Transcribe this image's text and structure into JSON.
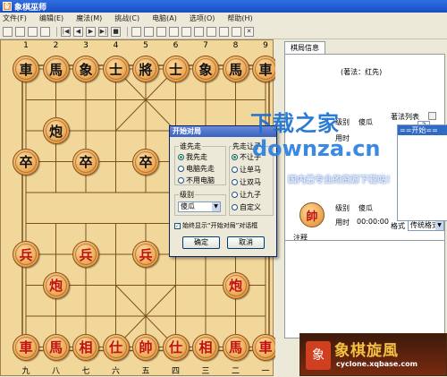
{
  "window": {
    "title": "象棋巫师"
  },
  "menu": [
    "文件(F)",
    "编辑(E)",
    "魔法(M)",
    "挑战(C)",
    "电脑(A)",
    "选项(O)",
    "帮助(H)"
  ],
  "board": {
    "top_numbers": [
      "1",
      "2",
      "3",
      "4",
      "5",
      "6",
      "7",
      "8",
      "9"
    ],
    "bottom_numbers": [
      "九",
      "八",
      "七",
      "六",
      "五",
      "四",
      "三",
      "二",
      "一"
    ],
    "pieces": [
      {
        "ch": "車",
        "side": "black",
        "col": 0,
        "row": 0
      },
      {
        "ch": "馬",
        "side": "black",
        "col": 1,
        "row": 0
      },
      {
        "ch": "象",
        "side": "black",
        "col": 2,
        "row": 0
      },
      {
        "ch": "士",
        "side": "black",
        "col": 3,
        "row": 0
      },
      {
        "ch": "將",
        "side": "black",
        "col": 4,
        "row": 0
      },
      {
        "ch": "士",
        "side": "black",
        "col": 5,
        "row": 0
      },
      {
        "ch": "象",
        "side": "black",
        "col": 6,
        "row": 0
      },
      {
        "ch": "馬",
        "side": "black",
        "col": 7,
        "row": 0
      },
      {
        "ch": "車",
        "side": "black",
        "col": 8,
        "row": 0
      },
      {
        "ch": "炮",
        "side": "black",
        "col": 1,
        "row": 2
      },
      {
        "ch": "卒",
        "side": "black",
        "col": 0,
        "row": 3
      },
      {
        "ch": "卒",
        "side": "black",
        "col": 2,
        "row": 3
      },
      {
        "ch": "卒",
        "side": "black",
        "col": 4,
        "row": 3
      },
      {
        "ch": "兵",
        "side": "red",
        "col": 0,
        "row": 6
      },
      {
        "ch": "兵",
        "side": "red",
        "col": 2,
        "row": 6
      },
      {
        "ch": "兵",
        "side": "red",
        "col": 4,
        "row": 6
      },
      {
        "ch": "炮",
        "side": "red",
        "col": 1,
        "row": 7
      },
      {
        "ch": "炮",
        "side": "red",
        "col": 7,
        "row": 7
      },
      {
        "ch": "車",
        "side": "red",
        "col": 0,
        "row": 9
      },
      {
        "ch": "馬",
        "side": "red",
        "col": 1,
        "row": 9
      },
      {
        "ch": "相",
        "side": "red",
        "col": 2,
        "row": 9
      },
      {
        "ch": "仕",
        "side": "red",
        "col": 3,
        "row": 9
      },
      {
        "ch": "帥",
        "side": "red",
        "col": 4,
        "row": 9
      },
      {
        "ch": "仕",
        "side": "red",
        "col": 5,
        "row": 9
      },
      {
        "ch": "相",
        "side": "red",
        "col": 6,
        "row": 9
      },
      {
        "ch": "馬",
        "side": "red",
        "col": 7,
        "row": 9
      },
      {
        "ch": "車",
        "side": "red",
        "col": 8,
        "row": 9
      }
    ]
  },
  "panel": {
    "tab": "棋局信息",
    "move_turn": "(著法：红先)",
    "level_label": "级别",
    "level_value": "傻瓜",
    "time_label": "用时",
    "time_value": "00:00:00",
    "movelist_label": "著法列表",
    "movelist_selected": "==开始==",
    "format_label": "格式",
    "format_value": "传统格式",
    "note_label": "注释",
    "red_avatar": "帥",
    "help_btn": "?"
  },
  "dialog": {
    "title": "开始对局",
    "who_first_label": "谁先走",
    "who_first": [
      "我先走",
      "电脑先走",
      "不用电脑"
    ],
    "handicap_label": "先走让子",
    "handicap": [
      "不让子",
      "让单马",
      "让双马",
      "让九子",
      "自定义"
    ],
    "level_label": "级别",
    "level_value": "傻瓜",
    "show_always": "始终显示“开始对局”对话框",
    "ok": "确定",
    "cancel": "取消"
  },
  "watermark": {
    "line1": "下载之家",
    "line2": "downza.cn",
    "line3": "国内最专业的资源下载站！"
  },
  "banner": {
    "title": "象棋旋風",
    "url": "cyclone.xqbase.com",
    "logo_char": "象"
  },
  "colors": {
    "red_piece": "#c01010",
    "black_piece": "#111111",
    "board": "#f2d79b",
    "title_blue": "#1a4fc4"
  }
}
